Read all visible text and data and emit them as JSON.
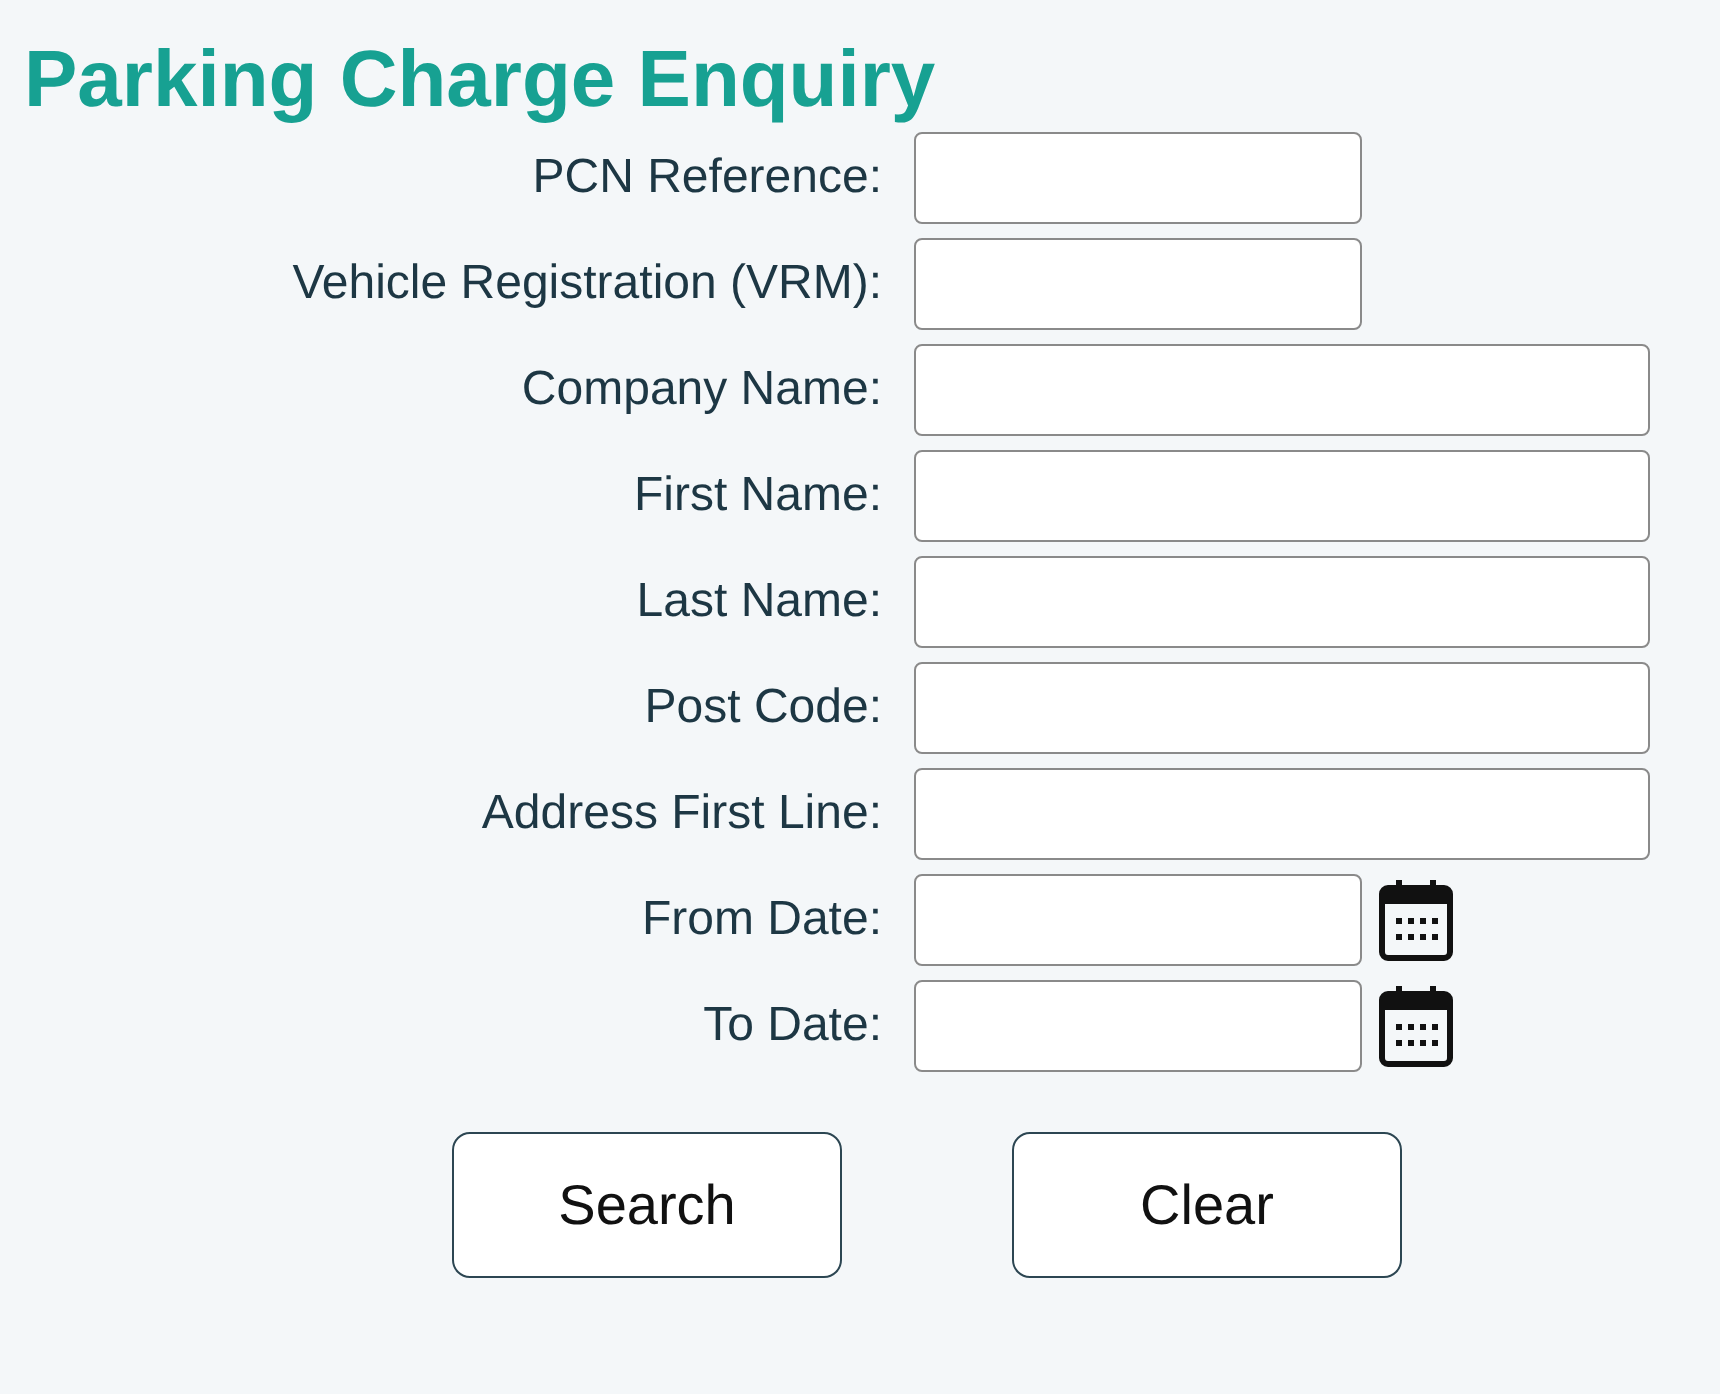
{
  "title": "Parking Charge Enquiry",
  "fields": [
    {
      "label": "PCN Reference:",
      "kind": "short"
    },
    {
      "label": "Vehicle Registration (VRM):",
      "kind": "short"
    },
    {
      "label": "Company Name:",
      "kind": "long"
    },
    {
      "label": "First Name:",
      "kind": "long"
    },
    {
      "label": "Last Name:",
      "kind": "long"
    },
    {
      "label": "Post Code:",
      "kind": "long"
    },
    {
      "label": "Address First Line:",
      "kind": "long"
    },
    {
      "label": "From Date:",
      "kind": "date"
    },
    {
      "label": "To Date:",
      "kind": "date"
    }
  ],
  "buttons": [
    "Search",
    "Clear"
  ]
}
